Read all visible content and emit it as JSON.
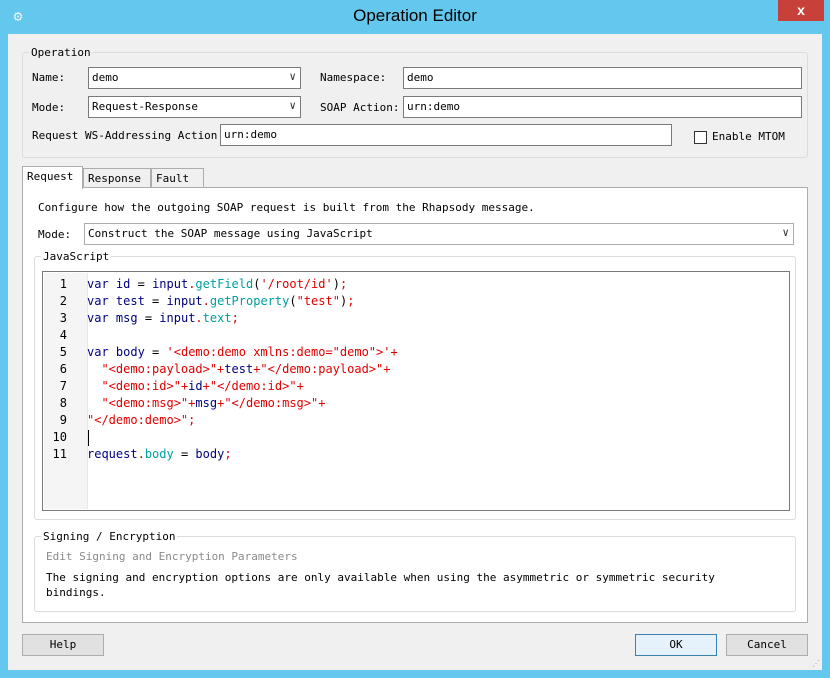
{
  "window": {
    "title": "Operation Editor",
    "close_label": "x",
    "app_icon": "gear-icon"
  },
  "operation": {
    "group_label": "Operation",
    "name_label": "Name:",
    "name_value": "demo",
    "mode_label": "Mode:",
    "mode_value": "Request-Response",
    "namespace_label": "Namespace:",
    "namespace_value": "demo",
    "soap_action_label": "SOAP Action:",
    "soap_action_value": "urn:demo",
    "ws_addressing_label": "Request WS-Addressing Action",
    "ws_addressing_value": "urn:demo",
    "enable_mtom_label": "Enable MTOM",
    "enable_mtom_checked": false
  },
  "tabs": [
    {
      "label": "Request",
      "active": true
    },
    {
      "label": "Response",
      "active": false
    },
    {
      "label": "Fault",
      "active": false
    }
  ],
  "request": {
    "description": "Configure how the outgoing SOAP request is built from the Rhapsody message.",
    "mode_label": "Mode:",
    "mode_value": "Construct the SOAP message using JavaScript",
    "javascript_group_label": "JavaScript",
    "code_lines": [
      "var id = input.getField('/root/id');",
      "var test = input.getProperty(\"test\");",
      "var msg = input.text;",
      "",
      "var body = '<demo:demo xmlns:demo=\"demo\">'+",
      "  \"<demo:payload>\"+test+\"</demo:payload>\"+",
      "  \"<demo:id>\"+id+\"</demo:id>\"+",
      "  \"<demo:msg>\"+msg+\"</demo:msg>\"+",
      "\"</demo:demo>\";",
      "",
      "request.body = body;"
    ],
    "line_numbers": [
      "1",
      "2",
      "3",
      "4",
      "5",
      "6",
      "7",
      "8",
      "9",
      "10",
      "11"
    ]
  },
  "signing": {
    "group_label": "Signing / Encryption",
    "link_label": "Edit Signing and Encryption Parameters",
    "note": "The signing and encryption options are only available when using the asymmetric or symmetric security bindings."
  },
  "buttons": {
    "help": "Help",
    "ok": "OK",
    "cancel": "Cancel"
  }
}
